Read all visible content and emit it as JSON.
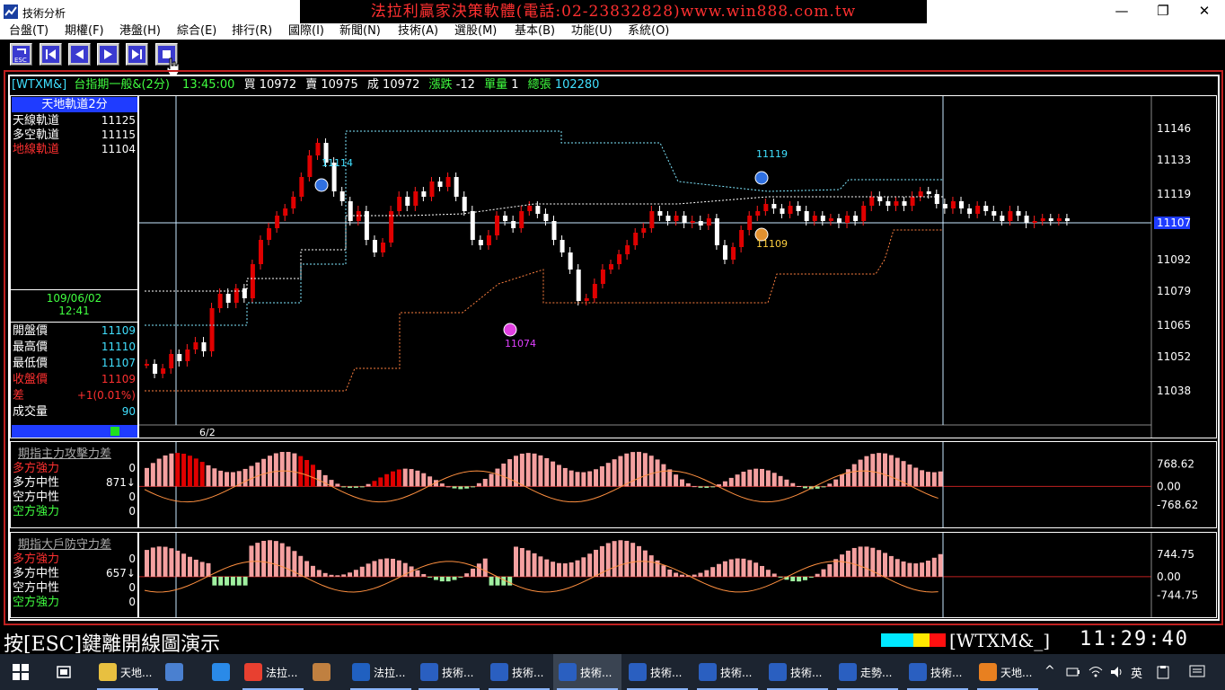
{
  "window": {
    "title": "技術分析",
    "banner": "法拉利贏家決策軟體(電話:02-23832828)www.win888.com.tw",
    "min": "—",
    "max": "❐",
    "close": "✕"
  },
  "menu": [
    "台盤(T)",
    "期權(F)",
    "港盤(H)",
    "綜合(E)",
    "排行(R)",
    "國際(I)",
    "新聞(N)",
    "技術(A)",
    "選股(M)",
    "基本(B)",
    "功能(U)",
    "系統(O)"
  ],
  "toolbar": {
    "esc_label": "ESC"
  },
  "quote": {
    "symbol": "[WTXM&]",
    "name": "台指期一般&(2分)",
    "time": "13:45:00",
    "buy_label": "買",
    "buy": "10972",
    "sell_label": "賣",
    "sell": "10975",
    "deal_label": "成",
    "deal": "10972",
    "chg_label": "漲跌",
    "chg": "-12",
    "vol_label": "單量",
    "vol": "1",
    "total_label": "總張",
    "total": "102280"
  },
  "left_panel": {
    "indicator_title": "天地軌道2分",
    "tracks": [
      {
        "label": "天線軌道",
        "value": "11125",
        "color": "#ffffff"
      },
      {
        "label": "多空軌道",
        "value": "11115",
        "color": "#ffffff"
      },
      {
        "label": "地線軌道",
        "value": "11104",
        "color": "#ff3030"
      }
    ],
    "date": "109/06/02",
    "time": "12:41",
    "ohlc": [
      {
        "label": "開盤價",
        "value": "11109",
        "lc": "#ffffff",
        "vc": "#40e0ff"
      },
      {
        "label": "最高價",
        "value": "11110",
        "lc": "#ffffff",
        "vc": "#40e0ff"
      },
      {
        "label": "最低價",
        "value": "11107",
        "lc": "#ffffff",
        "vc": "#40e0ff"
      },
      {
        "label": "收盤價",
        "value": "11109",
        "lc": "#ff3030",
        "vc": "#ff3030"
      },
      {
        "label": "差",
        "value": "+1(0.01%)",
        "lc": "#ff3030",
        "vc": "#ff3030"
      },
      {
        "label": "成交量",
        "value": "90",
        "lc": "#ffffff",
        "vc": "#40e0ff"
      }
    ]
  },
  "main_chart": {
    "yticks": [
      "11146",
      "11133",
      "11119",
      "11092",
      "11079",
      "11065",
      "11052",
      "11038"
    ],
    "current_price": "11107",
    "date_label": "6/2",
    "annotations": [
      {
        "text": "11114",
        "color": "#40e0ff"
      },
      {
        "text": "11119",
        "color": "#40e0ff"
      },
      {
        "text": "11109",
        "color": "#ffd040"
      },
      {
        "text": "11074",
        "color": "#e040ff"
      }
    ]
  },
  "sub1": {
    "title": "期指主力攻擊力差",
    "rows": [
      {
        "label": "多方強力",
        "value": "0",
        "color": "#ff3030"
      },
      {
        "label": "多方中性",
        "value": "871↓",
        "color": "#ffffff"
      },
      {
        "label": "空方中性",
        "value": "0",
        "color": "#ffffff"
      },
      {
        "label": "空方強力",
        "value": "0",
        "color": "#40ff40"
      }
    ],
    "yticks": [
      "768.62",
      "0.00",
      "-768.62"
    ]
  },
  "sub2": {
    "title": "期指大戶防守力差",
    "rows": [
      {
        "label": "多方強力",
        "value": "0",
        "color": "#ff3030"
      },
      {
        "label": "多方中性",
        "value": "657↓",
        "color": "#ffffff"
      },
      {
        "label": "空方中性",
        "value": "0",
        "color": "#ffffff"
      },
      {
        "label": "空方強力",
        "value": "0",
        "color": "#40ff40"
      }
    ],
    "yticks": [
      "744.75",
      "0.00",
      "-744.75"
    ]
  },
  "status": {
    "hint": "按[ESC]鍵離開線圖演示",
    "symbol": "[WTXM&_]",
    "clock": "11:29:40"
  },
  "taskbar": {
    "items": [
      "天地...",
      "",
      "",
      "法拉...",
      "",
      "法拉...",
      "技術...",
      "技術...",
      "技術...",
      "技術...",
      "技術...",
      "技術...",
      "走勢...",
      "技術...",
      "天地..."
    ],
    "ime": "英",
    "up_arrow": "^"
  }
}
